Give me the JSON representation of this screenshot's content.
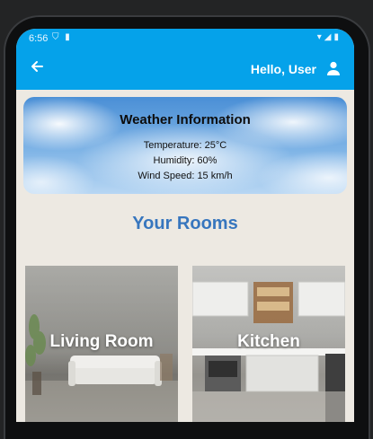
{
  "status_bar": {
    "time": "6:56"
  },
  "app_bar": {
    "greeting": "Hello, User",
    "color": "#05a2ea",
    "back_icon": "arrow-left-icon",
    "user_icon": "person-icon"
  },
  "weather": {
    "title": "Weather Information",
    "temperature": "Temperature: 25°C",
    "humidity": "Humidity: 60%",
    "wind_speed": "Wind Speed: 15 km/h"
  },
  "rooms_section": {
    "title": "Your Rooms",
    "title_color": "#3776be",
    "rooms": [
      {
        "label": "Living Room"
      },
      {
        "label": "Kitchen"
      }
    ]
  }
}
